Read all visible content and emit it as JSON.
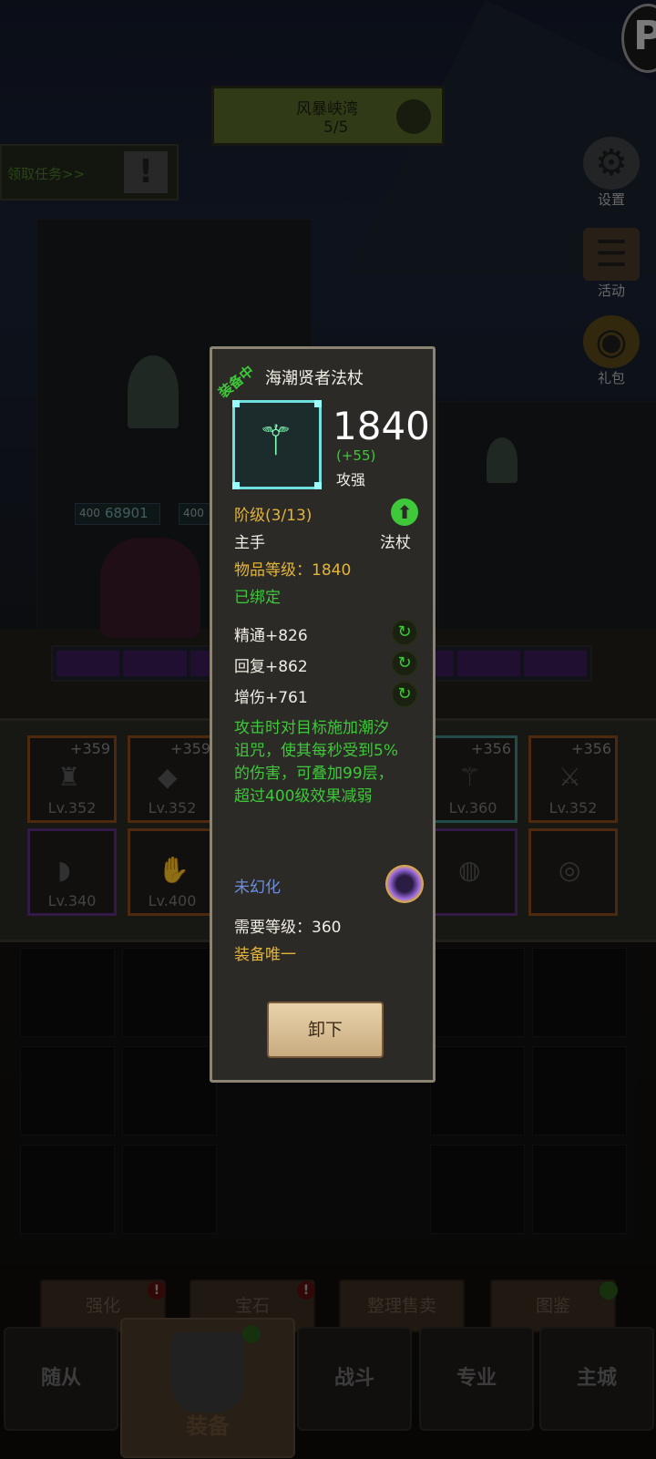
{
  "hud": {
    "quest_title": "风暴峡湾",
    "quest_progress": "5/5",
    "task_link": "领取任务>>",
    "task_alert": "!",
    "profile_badge": "P",
    "side_menu": [
      {
        "label": "设置",
        "icon": "gear-icon"
      },
      {
        "label": "活动",
        "icon": "scroll-icon"
      },
      {
        "label": "礼包",
        "icon": "chest-icon"
      }
    ]
  },
  "hero": {
    "hp_left": "400",
    "hp_value": "68901",
    "hp_right": "400"
  },
  "equipment_slots": [
    {
      "plus": "+359",
      "level": "Lv.352",
      "rarity": "orange"
    },
    {
      "plus": "+359",
      "level": "Lv.352",
      "rarity": "orange"
    },
    {
      "plus": "+356",
      "level": "Lv.360",
      "rarity": "teal"
    },
    {
      "plus": "+356",
      "level": "Lv.352",
      "rarity": "orange"
    },
    {
      "plus": "",
      "level": "Lv.340",
      "rarity": "purple"
    },
    {
      "plus": "",
      "level": "Lv.400",
      "rarity": "orange"
    },
    {
      "plus": "",
      "level": "",
      "rarity": "purple"
    },
    {
      "plus": "",
      "level": "",
      "rarity": "orange"
    }
  ],
  "item_tooltip": {
    "equipped_tag": "装备中",
    "name": "海潮贤者法杖",
    "score": "1840",
    "score_delta": "(+55)",
    "score_stat": "攻强",
    "tier": "阶级(3/13)",
    "slot": "主手",
    "item_type": "法杖",
    "item_level": "物品等级：1840",
    "bound": "已绑定",
    "stats": [
      "精通+826",
      "回复+862",
      "增伤+761"
    ],
    "effect": "攻击时对目标施加潮汐诅咒，使其每秒受到5%的伤害，可叠加99层，超过400级效果减弱",
    "transmog": "未幻化",
    "required_level": "需要等级：360",
    "unique": "装备唯一",
    "unequip_button": "卸下"
  },
  "actions": [
    {
      "label": "强化",
      "badge": "!"
    },
    {
      "label": "宝石",
      "badge": "!"
    },
    {
      "label": "整理售卖",
      "badge": ""
    },
    {
      "label": "图鉴",
      "badge": ""
    }
  ],
  "bottom_nav": {
    "tabs": [
      "随从",
      "装备",
      "战斗",
      "专业",
      "主城"
    ],
    "active": "装备"
  },
  "colors": {
    "equipped_green": "#3ec83a",
    "gold_text": "#e3b43a",
    "transmog_blue": "#6d8ee0",
    "legendary_frame": "#6fe0e0"
  }
}
